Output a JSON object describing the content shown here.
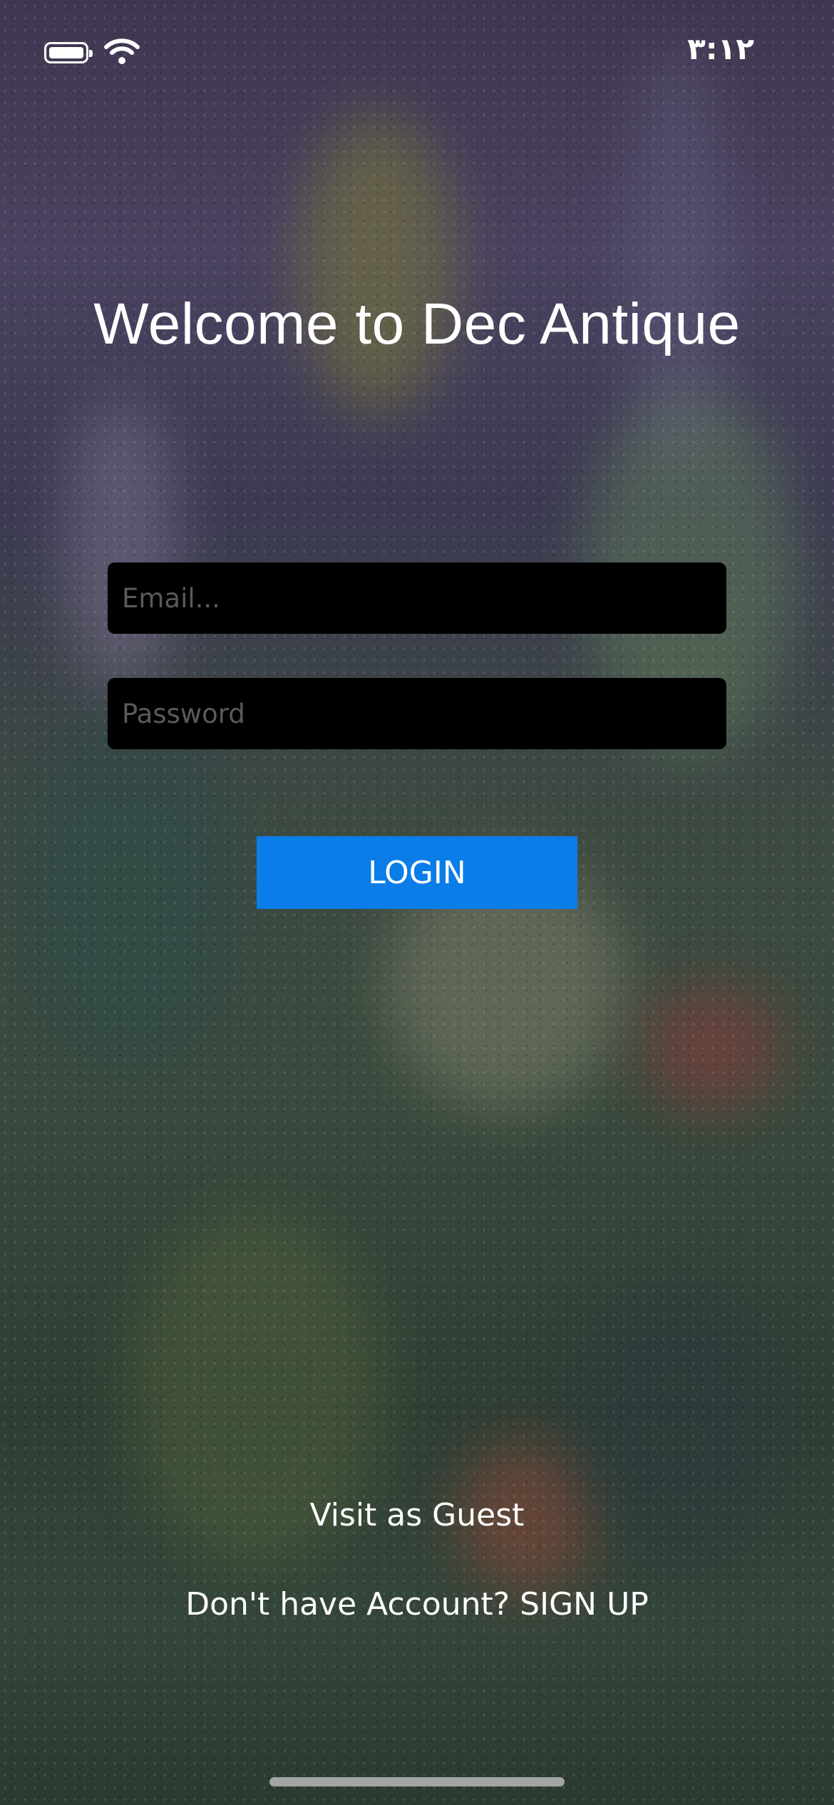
{
  "status_bar": {
    "time": "٣:١٢",
    "icons": [
      "battery-icon",
      "wifi-icon"
    ]
  },
  "title": "Welcome to Dec Antique",
  "form": {
    "email_placeholder": "Email...",
    "password_placeholder": "Password",
    "login_label": "LOGIN"
  },
  "footer": {
    "guest_label": "Visit as Guest",
    "signup_prompt": "Don't have Account?",
    "signup_label": "SIGN UP"
  },
  "colors": {
    "accent": "#0a7de8",
    "field_background": "#000000",
    "text": "#ffffff"
  }
}
